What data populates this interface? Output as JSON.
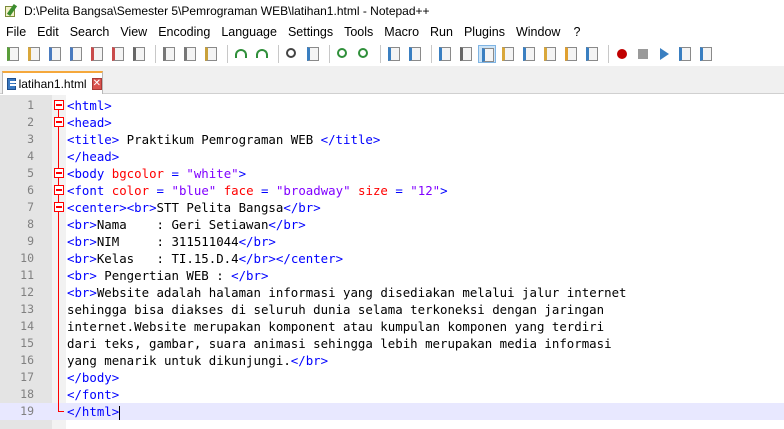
{
  "window": {
    "title": "D:\\Pelita Bangsa\\Semester 5\\Pemrograman WEB\\latihan1.html - Notepad++"
  },
  "menu": [
    "File",
    "Edit",
    "Search",
    "View",
    "Encoding",
    "Language",
    "Settings",
    "Tools",
    "Macro",
    "Run",
    "Plugins",
    "Window",
    "?"
  ],
  "toolbar": {
    "icons": [
      "new-file-icon",
      "open-file-icon",
      "save-icon",
      "save-all-icon",
      "close-icon",
      "close-all-icon",
      "print-icon",
      "cut-icon",
      "copy-icon",
      "paste-icon",
      "undo-icon",
      "redo-icon",
      "find-icon",
      "replace-icon",
      "zoom-in-icon",
      "zoom-out-icon",
      "sync-vertical-icon",
      "sync-horizontal-icon",
      "word-wrap-icon",
      "show-all-chars-icon",
      "indent-guide-icon",
      "udl-icon",
      "doc-map-icon",
      "function-list-icon",
      "folder-workspace-icon",
      "monitor-icon",
      "record-macro-icon",
      "stop-record-icon",
      "play-macro-icon",
      "run-macro-multiple-icon",
      "save-macro-icon"
    ]
  },
  "tab": {
    "label": "latihan1.html",
    "close_glyph": "✕"
  },
  "editor": {
    "current_line": 19,
    "lines": [
      {
        "n": "1",
        "tokens": [
          [
            "tag",
            "<html>"
          ]
        ]
      },
      {
        "n": "2",
        "tokens": [
          [
            "tag",
            "<head>"
          ]
        ]
      },
      {
        "n": "3",
        "tokens": [
          [
            "tag",
            "<title>"
          ],
          [
            "txt",
            " Praktikum Pemrograman WEB "
          ],
          [
            "tag",
            "</title>"
          ]
        ]
      },
      {
        "n": "4",
        "tokens": [
          [
            "tag",
            "</head>"
          ]
        ]
      },
      {
        "n": "5",
        "tokens": [
          [
            "tag",
            "<body "
          ],
          [
            "attr",
            "bgcolor"
          ],
          [
            "txt",
            " "
          ],
          [
            "tag",
            "="
          ],
          [
            "txt",
            " "
          ],
          [
            "str",
            "\"white\""
          ],
          [
            "tag",
            ">"
          ]
        ]
      },
      {
        "n": "6",
        "tokens": [
          [
            "tag",
            "<font "
          ],
          [
            "attr",
            "color"
          ],
          [
            "txt",
            " "
          ],
          [
            "tag",
            "="
          ],
          [
            "txt",
            " "
          ],
          [
            "str",
            "\"blue\""
          ],
          [
            "txt",
            " "
          ],
          [
            "attr",
            "face"
          ],
          [
            "txt",
            " "
          ],
          [
            "tag",
            "="
          ],
          [
            "txt",
            " "
          ],
          [
            "str",
            "\"broadway\""
          ],
          [
            "txt",
            " "
          ],
          [
            "attr",
            "size"
          ],
          [
            "txt",
            " "
          ],
          [
            "tag",
            "="
          ],
          [
            "txt",
            " "
          ],
          [
            "str",
            "\"12\""
          ],
          [
            "tag",
            ">"
          ]
        ]
      },
      {
        "n": "7",
        "tokens": [
          [
            "tag",
            "<center>"
          ],
          [
            "tag",
            "<br>"
          ],
          [
            "txt",
            "STT Pelita Bangsa"
          ],
          [
            "tag",
            "</br>"
          ]
        ]
      },
      {
        "n": "8",
        "tokens": [
          [
            "tag",
            "<br>"
          ],
          [
            "txt",
            "Nama    : Geri Setiawan"
          ],
          [
            "tag",
            "</br>"
          ]
        ]
      },
      {
        "n": "9",
        "tokens": [
          [
            "tag",
            "<br>"
          ],
          [
            "txt",
            "NIM     : 311511044"
          ],
          [
            "tag",
            "</br>"
          ]
        ]
      },
      {
        "n": "10",
        "tokens": [
          [
            "tag",
            "<br>"
          ],
          [
            "txt",
            "Kelas   : TI.15.D.4"
          ],
          [
            "tag",
            "</br>"
          ],
          [
            "tag",
            "</center>"
          ]
        ]
      },
      {
        "n": "11",
        "tokens": [
          [
            "tag",
            "<br>"
          ],
          [
            "txt",
            " Pengertian WEB : "
          ],
          [
            "tag",
            "</br>"
          ]
        ]
      },
      {
        "n": "12",
        "tokens": [
          [
            "tag",
            "<br>"
          ],
          [
            "txt",
            "Website adalah halaman informasi yang disediakan melalui jalur internet"
          ]
        ]
      },
      {
        "n": "13",
        "tokens": [
          [
            "txt",
            "sehingga bisa diakses di seluruh dunia selama terkoneksi dengan jaringan"
          ]
        ]
      },
      {
        "n": "14",
        "tokens": [
          [
            "txt",
            "internet.Website merupakan komponent atau kumpulan komponen yang terdiri"
          ]
        ]
      },
      {
        "n": "15",
        "tokens": [
          [
            "txt",
            "dari teks, gambar, suara animasi sehingga lebih merupakan media informasi"
          ]
        ]
      },
      {
        "n": "16",
        "tokens": [
          [
            "txt",
            "yang menarik untuk dikunjungi."
          ],
          [
            "tag",
            "</br>"
          ]
        ]
      },
      {
        "n": "17",
        "tokens": [
          [
            "tag",
            "</body>"
          ]
        ]
      },
      {
        "n": "18",
        "tokens": [
          [
            "tag",
            "</font>"
          ]
        ]
      },
      {
        "n": "19",
        "tokens": [
          [
            "tag",
            "</html>"
          ]
        ]
      }
    ],
    "fold_markers": {
      "boxes": [
        1,
        2,
        5,
        6,
        7
      ],
      "end": 19
    }
  }
}
